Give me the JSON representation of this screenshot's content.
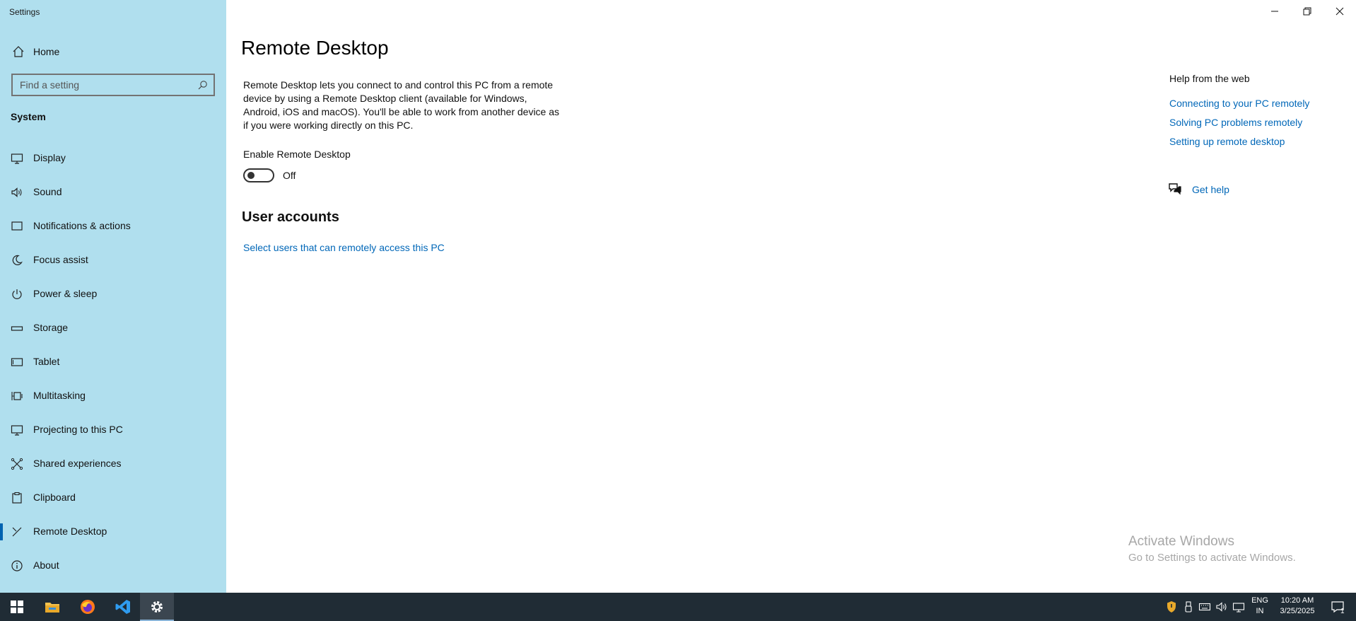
{
  "window": {
    "title": "Settings"
  },
  "sidebar": {
    "home_label": "Home",
    "search_placeholder": "Find a setting",
    "section": "System",
    "items": [
      {
        "label": "Display",
        "icon": "monitor-icon"
      },
      {
        "label": "Sound",
        "icon": "speaker-icon"
      },
      {
        "label": "Notifications & actions",
        "icon": "notification-icon"
      },
      {
        "label": "Focus assist",
        "icon": "moon-icon"
      },
      {
        "label": "Power & sleep",
        "icon": "power-icon"
      },
      {
        "label": "Storage",
        "icon": "storage-icon"
      },
      {
        "label": "Tablet",
        "icon": "tablet-icon"
      },
      {
        "label": "Multitasking",
        "icon": "multitasking-icon"
      },
      {
        "label": "Projecting to this PC",
        "icon": "projector-icon"
      },
      {
        "label": "Shared experiences",
        "icon": "shared-icon"
      },
      {
        "label": "Clipboard",
        "icon": "clipboard-icon"
      },
      {
        "label": "Remote Desktop",
        "icon": "remote-desktop-icon",
        "active": true
      },
      {
        "label": "About",
        "icon": "info-icon"
      }
    ]
  },
  "main": {
    "title": "Remote Desktop",
    "description": "Remote Desktop lets you connect to and control this PC from a remote device by using a Remote Desktop client (available for Windows, Android, iOS and macOS). You'll be able to work from another device as if you were working directly on this PC.",
    "toggle_label": "Enable Remote Desktop",
    "toggle_state": "Off",
    "user_accounts_heading": "User accounts",
    "user_accounts_link": "Select users that can remotely access this PC"
  },
  "help": {
    "heading": "Help from the web",
    "links": [
      "Connecting to your PC remotely",
      "Solving PC problems remotely",
      "Setting up remote desktop"
    ],
    "get_help": "Get help"
  },
  "watermark": {
    "line1": "Activate Windows",
    "line2": "Go to Settings to activate Windows."
  },
  "taskbar": {
    "apps": [
      "start-icon",
      "file-explorer-icon",
      "firefox-icon",
      "vscode-icon",
      "settings-icon"
    ],
    "language": "ENG",
    "region": "IN",
    "time": "10:20 AM",
    "date": "3/25/2025",
    "notification_count": "1"
  },
  "colors": {
    "sidebar_bg": "#b0dfee",
    "link": "#0067b8",
    "taskbar": "#202c35",
    "accent": "#0063b1"
  }
}
